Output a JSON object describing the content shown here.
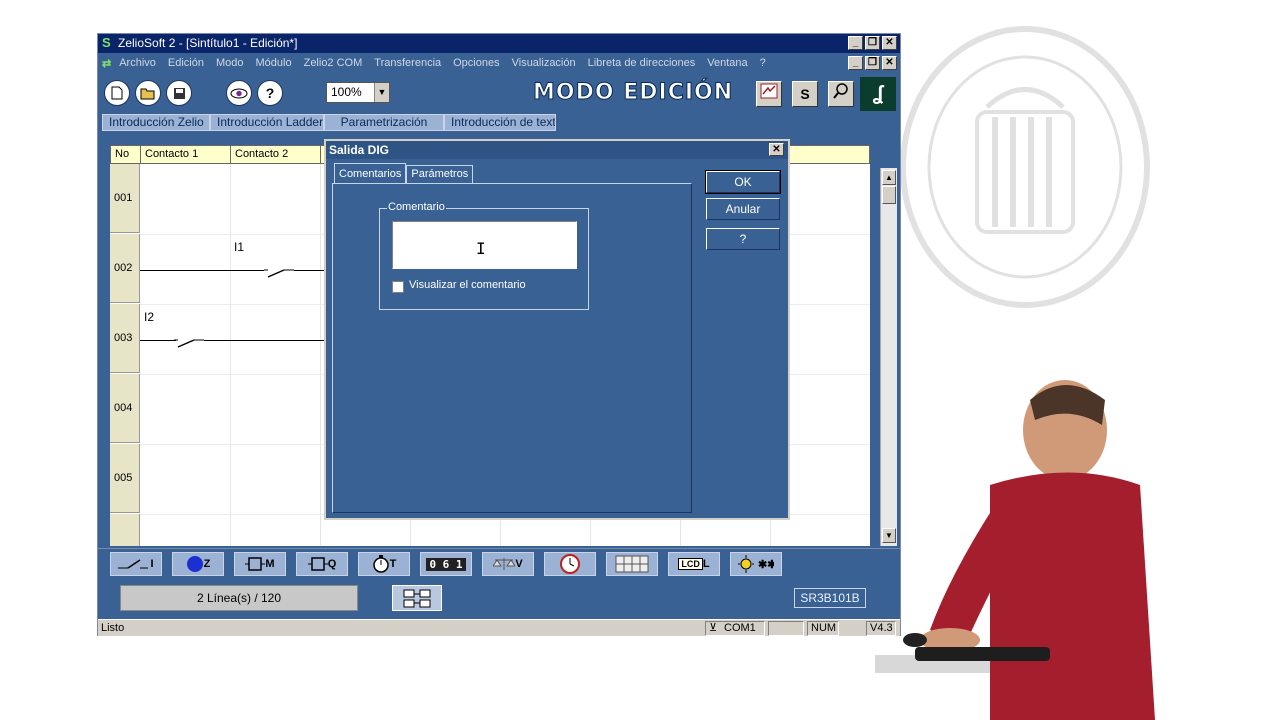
{
  "window": {
    "title": "ZelioSoft 2 - [Sintítulo1 - Edición*]",
    "min_btn": "_",
    "max_btn": "❐",
    "close_btn": "✕"
  },
  "menu": {
    "items": [
      "Archivo",
      "Edición",
      "Modo",
      "Módulo",
      "Zelio2 COM",
      "Transferencia",
      "Opciones",
      "Visualización",
      "Libreta de direcciones",
      "Ventana",
      "?"
    ]
  },
  "toolbar": {
    "new_icon": "new-file-icon",
    "open_icon": "open-folder-icon",
    "save_icon": "save-disk-icon",
    "view_icon": "eye-icon",
    "help_label": "?",
    "zoom_value": "100%",
    "mode_title": "MODO EDICIÓN",
    "s_label": "S",
    "logo_label": "ʆ"
  },
  "tabs": [
    "Introducción Zelio",
    "Introducción Ladder",
    "Parametrización",
    "Introducción de texto"
  ],
  "grid": {
    "headers": [
      "No",
      "Contacto 1",
      "Contacto 2"
    ],
    "rows": [
      "001",
      "002",
      "003",
      "004",
      "005"
    ],
    "labels": {
      "i1": "I1",
      "i2": "I2"
    }
  },
  "palette": {
    "items": [
      {
        "name": "contact-i",
        "label": "I"
      },
      {
        "name": "coil-z",
        "label": "Z"
      },
      {
        "name": "coil-m",
        "label": "M"
      },
      {
        "name": "coil-q",
        "label": "Q"
      },
      {
        "name": "timer-t",
        "label": "T"
      },
      {
        "name": "counter",
        "label": "0 6 1"
      },
      {
        "name": "comparator-v",
        "label": "V"
      },
      {
        "name": "clock",
        "label": ""
      },
      {
        "name": "texts",
        "label": ""
      },
      {
        "name": "lcd-l",
        "label": "L"
      },
      {
        "name": "sun",
        "label": ""
      }
    ]
  },
  "status": {
    "lines": "2 Línea(s) / 120",
    "model": "SR3B101B",
    "ready": "Listo",
    "com": "COM1",
    "num": "NUM",
    "version": "V4.3"
  },
  "dialog": {
    "title": "Salida DIG",
    "tabs": [
      "Comentarios",
      "Parámetros"
    ],
    "group_label": "Comentario",
    "comment_value": "",
    "checkbox_label": "Visualizar el comentario",
    "ok": "OK",
    "cancel": "Anular",
    "help": "?",
    "close": "✕"
  },
  "colors": {
    "app_bg": "#3a6193",
    "grid_header": "#ffffcc"
  }
}
